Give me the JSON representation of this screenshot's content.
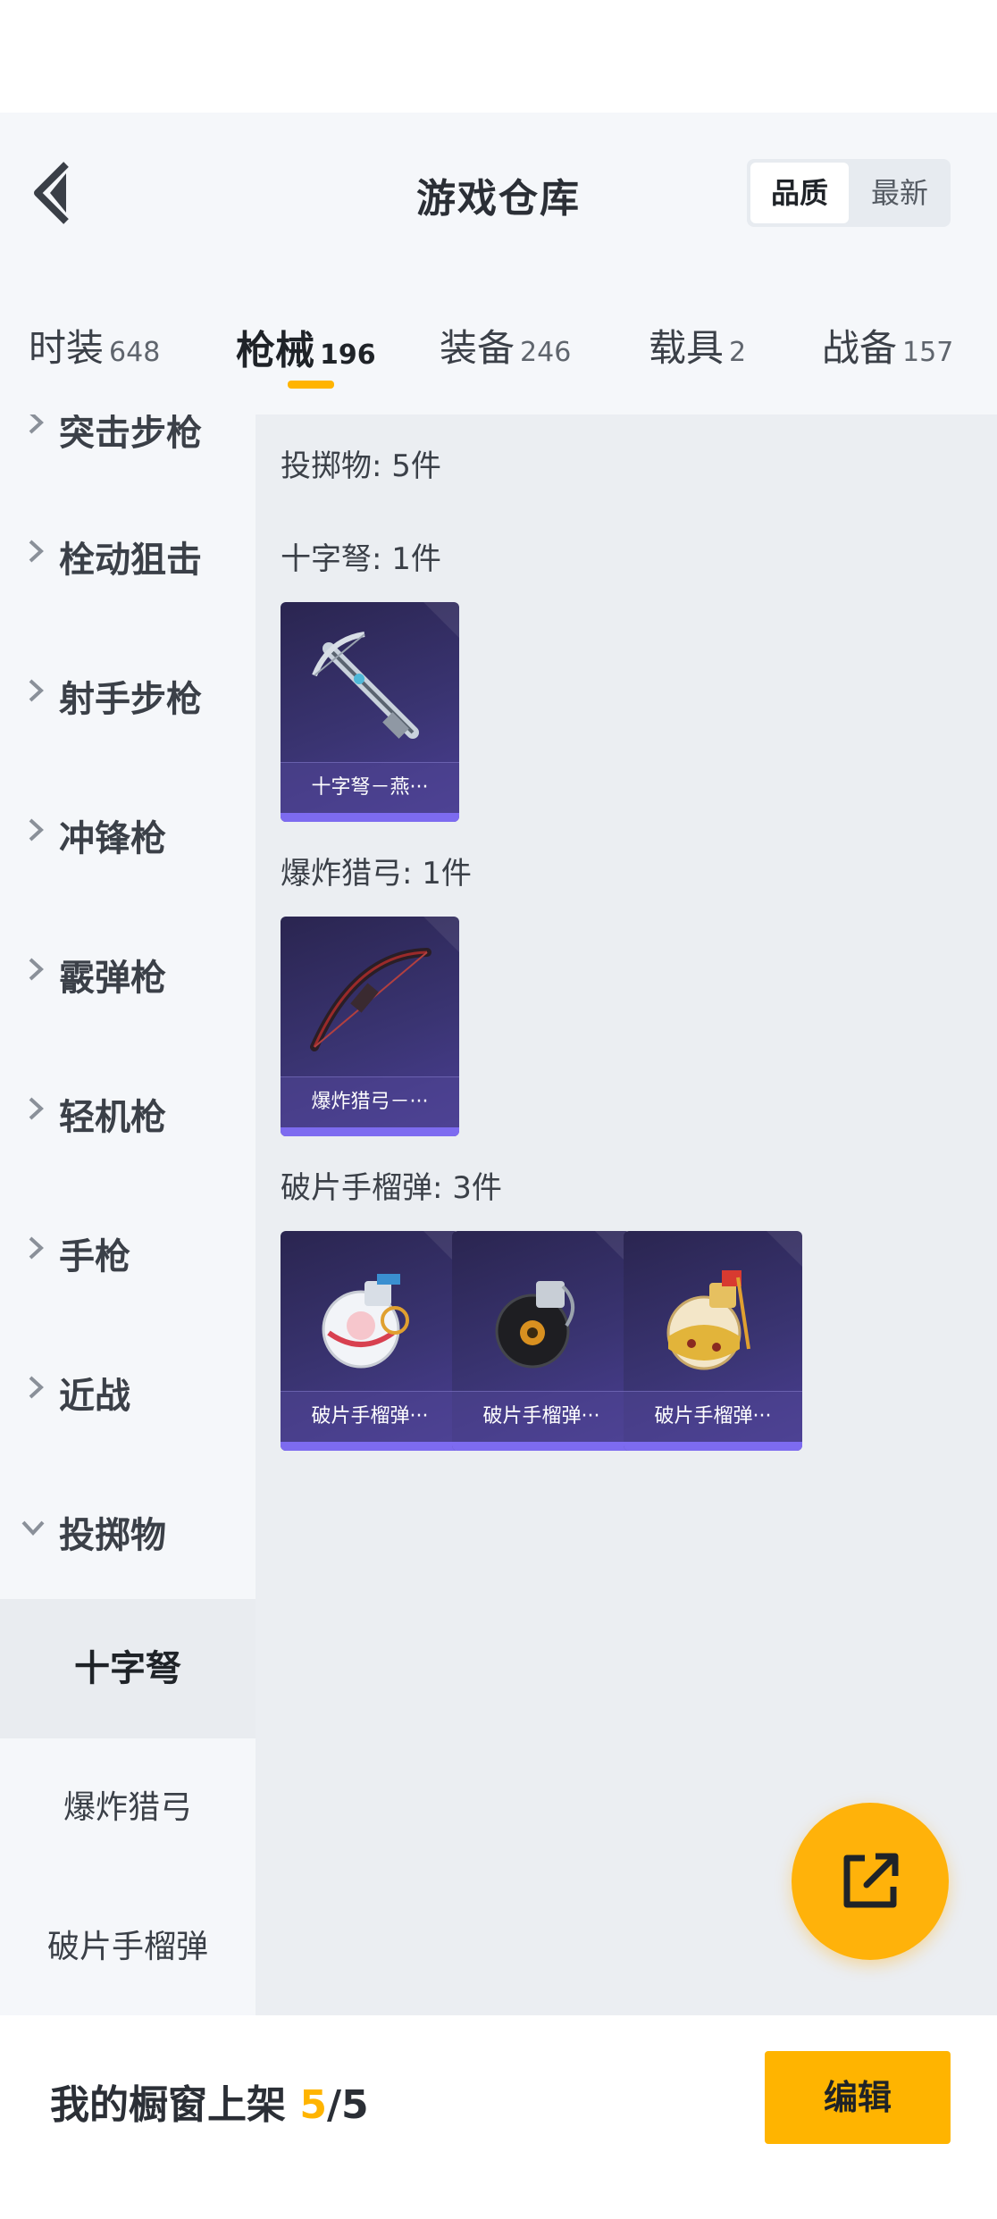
{
  "header": {
    "title": "游戏仓库",
    "sort": {
      "active": "品质",
      "inactive": "最新"
    }
  },
  "tabs": [
    {
      "label": "时装",
      "count": "648"
    },
    {
      "label": "枪械",
      "count": "196"
    },
    {
      "label": "装备",
      "count": "246"
    },
    {
      "label": "载具",
      "count": "2"
    },
    {
      "label": "战备",
      "count": "157"
    }
  ],
  "sidebar": {
    "categories": [
      {
        "label": "突击步枪",
        "icon": "chevron-right-icon"
      },
      {
        "label": "栓动狙击",
        "icon": "chevron-right-icon"
      },
      {
        "label": "射手步枪",
        "icon": "chevron-right-icon"
      },
      {
        "label": "冲锋枪",
        "icon": "chevron-right-icon"
      },
      {
        "label": "霰弹枪",
        "icon": "chevron-right-icon"
      },
      {
        "label": "轻机枪",
        "icon": "chevron-right-icon"
      },
      {
        "label": "手枪",
        "icon": "chevron-right-icon"
      },
      {
        "label": "近战",
        "icon": "chevron-right-icon"
      },
      {
        "label": "投掷物",
        "icon": "chevron-down-icon"
      }
    ],
    "subitems": [
      {
        "label": "十字弩"
      },
      {
        "label": "爆炸猎弓"
      },
      {
        "label": "破片手榴弹"
      }
    ]
  },
  "content": {
    "summary": "投掷物: 5件",
    "groups": [
      {
        "heading": "十字弩: 1件",
        "items": [
          {
            "name": "十字弩－燕···",
            "icon": "crossbow-icon"
          }
        ]
      },
      {
        "heading": "爆炸猎弓: 1件",
        "items": [
          {
            "name": "爆炸猎弓－···",
            "icon": "bow-icon"
          }
        ]
      },
      {
        "heading": "破片手榴弹: 3件",
        "items": [
          {
            "name": "破片手榴弹···",
            "icon": "grenade-white-icon"
          },
          {
            "name": "破片手榴弹···",
            "icon": "grenade-black-icon"
          },
          {
            "name": "破片手榴弹···",
            "icon": "grenade-gold-icon"
          }
        ]
      }
    ]
  },
  "fab": {
    "icon": "share-external-icon"
  },
  "bottom": {
    "prefix": "我的橱窗上架 ",
    "current": "5",
    "total": "/5",
    "edit_label": "编辑"
  },
  "colors": {
    "accent": "#ffb400",
    "card_bg": "#3a3472",
    "rarity": "#7d6bf0"
  }
}
